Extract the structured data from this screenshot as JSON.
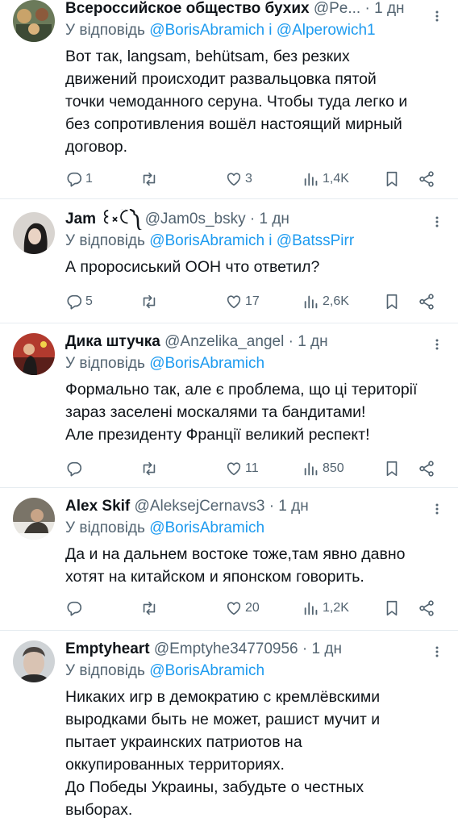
{
  "tweets": [
    {
      "name": "Всероссийское общество бухих",
      "handle": "@Pe...",
      "dot": "·",
      "time": "1 дн",
      "reply_prefix": "У відповідь",
      "reply_to": "@BorisAbramich і @Alperowich1",
      "lines": [
        "Вот так, langsam, behütsam, без резких",
        "движений происходит развальцовка пятой",
        "точки чемоданного серуна. Чтобы туда легко и",
        "без сопротивления вошёл настоящий мирный",
        "договор."
      ],
      "replies": "1",
      "retweets": "",
      "likes": "3",
      "views": "1,4K"
    },
    {
      "name": "Jam ꒰༝ꉓ༽",
      "handle": "@Jam0s_bsky",
      "dot": "·",
      "time": "1 дн",
      "reply_prefix": "У відповідь",
      "reply_to": "@BorisAbramich і @BatssPirr",
      "lines": [
        "А проросиський ООН что ответил?"
      ],
      "replies": "5",
      "retweets": "",
      "likes": "17",
      "views": "2,6K"
    },
    {
      "name": "Дика штучка",
      "handle": "@Anzelika_angel",
      "dot": "·",
      "time": "1 дн",
      "reply_prefix": "У відповідь",
      "reply_to": "@BorisAbramich",
      "lines": [
        "Формально так, але є проблема, що ці території",
        "зараз заселені москалями та бандитами!",
        "Але президенту Франції великий респект!"
      ],
      "replies": "",
      "retweets": "",
      "likes": "11",
      "views": "850"
    },
    {
      "name": "Alex Skif",
      "handle": "@AleksejCernavs3",
      "dot": "·",
      "time": "1 дн",
      "reply_prefix": "У відповідь",
      "reply_to": "@BorisAbramich",
      "lines": [
        "Да и на дальнем востоке тоже,там явно давно",
        "хотят на китайском и японском говорить."
      ],
      "replies": "",
      "retweets": "",
      "likes": "20",
      "views": "1,2K"
    },
    {
      "name": "Emptyheart",
      "handle": "@Emptyhe34770956",
      "dot": "·",
      "time": "1 дн",
      "reply_prefix": "У відповідь",
      "reply_to": "@BorisAbramich",
      "lines": [
        "Никаких игр в демократию с кремлёвскими",
        "выродками быть не может, рашист мучит и",
        "пытает украинских патриотов на",
        "оккупированных территориях.",
        "До Победы Украины, забудьте о честных",
        "выборах."
      ],
      "replies": "",
      "retweets": "",
      "likes": "",
      "views": ""
    }
  ],
  "icons": {
    "reply": "reply-icon",
    "retweet": "retweet-icon",
    "like": "like-icon",
    "views": "views-icon",
    "bookmark": "bookmark-icon",
    "share": "share-icon",
    "more": "more-icon"
  },
  "colors": {
    "link": "#1d9bf0",
    "secondary": "#536471",
    "text": "#0f1419",
    "divider": "#e6ecf0"
  }
}
